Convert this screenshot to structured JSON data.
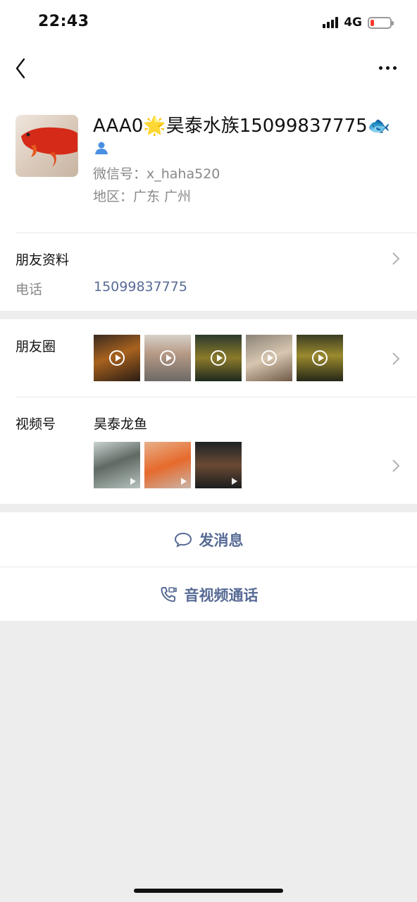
{
  "status_bar": {
    "time": "22:43",
    "network": "4G"
  },
  "profile": {
    "nickname": "AAA0🌟昊泰水族15099837775🐟",
    "wechat_id": "微信号：x_haha520",
    "region": "地区：广东 广州"
  },
  "friend_info": {
    "label": "朋友资料",
    "phone_label": "电话",
    "phone_value": "15099837775"
  },
  "moments": {
    "label": "朋友圈",
    "thumb_count": 5
  },
  "channels": {
    "label": "视频号",
    "name": "昊泰龙鱼",
    "thumb_count": 3
  },
  "actions": {
    "message": "发消息",
    "call": "音视频通话"
  },
  "colors": {
    "link": "#576b95",
    "background": "#ededed"
  }
}
